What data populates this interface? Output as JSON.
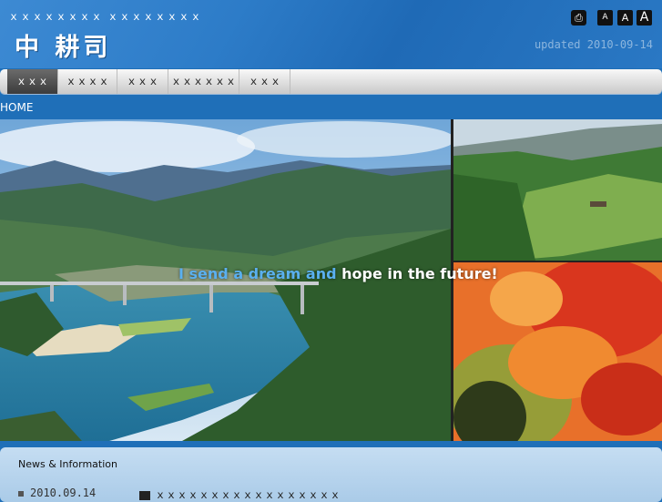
{
  "header": {
    "tagline": "ｘｘｘｘｘｘｘｘ ｘｘｘｘｘｘｘｘ",
    "logo_text": "中 耕司",
    "updated": "updated 2010-09-14",
    "font_size_labels": [
      "A",
      "A",
      "A"
    ]
  },
  "nav": {
    "items": [
      {
        "label": "ｘｘｘ",
        "active": true
      },
      {
        "label": "ｘｘｘｘ",
        "active": false
      },
      {
        "label": "ｘｘｘ",
        "active": false
      },
      {
        "label": "ｘｘｘｘｘｘ",
        "active": false
      },
      {
        "label": "ｘｘｘ",
        "active": false
      }
    ]
  },
  "breadcrumb": {
    "label": "HOME"
  },
  "hero": {
    "slogan_blue": "I send a dream and",
    "slogan_white": " hope in the future!"
  },
  "news": {
    "heading": "News & Information",
    "items": [
      {
        "date": "2010.09.14",
        "text": "ｘｘｘｘｘｘｘｘｘｘｘｘｘｘｘｘｘ"
      }
    ]
  },
  "colors": {
    "header_blue": "#2d7cc8",
    "nav_active": "#4a4a4a",
    "news_bg": "#b8d4ee"
  }
}
